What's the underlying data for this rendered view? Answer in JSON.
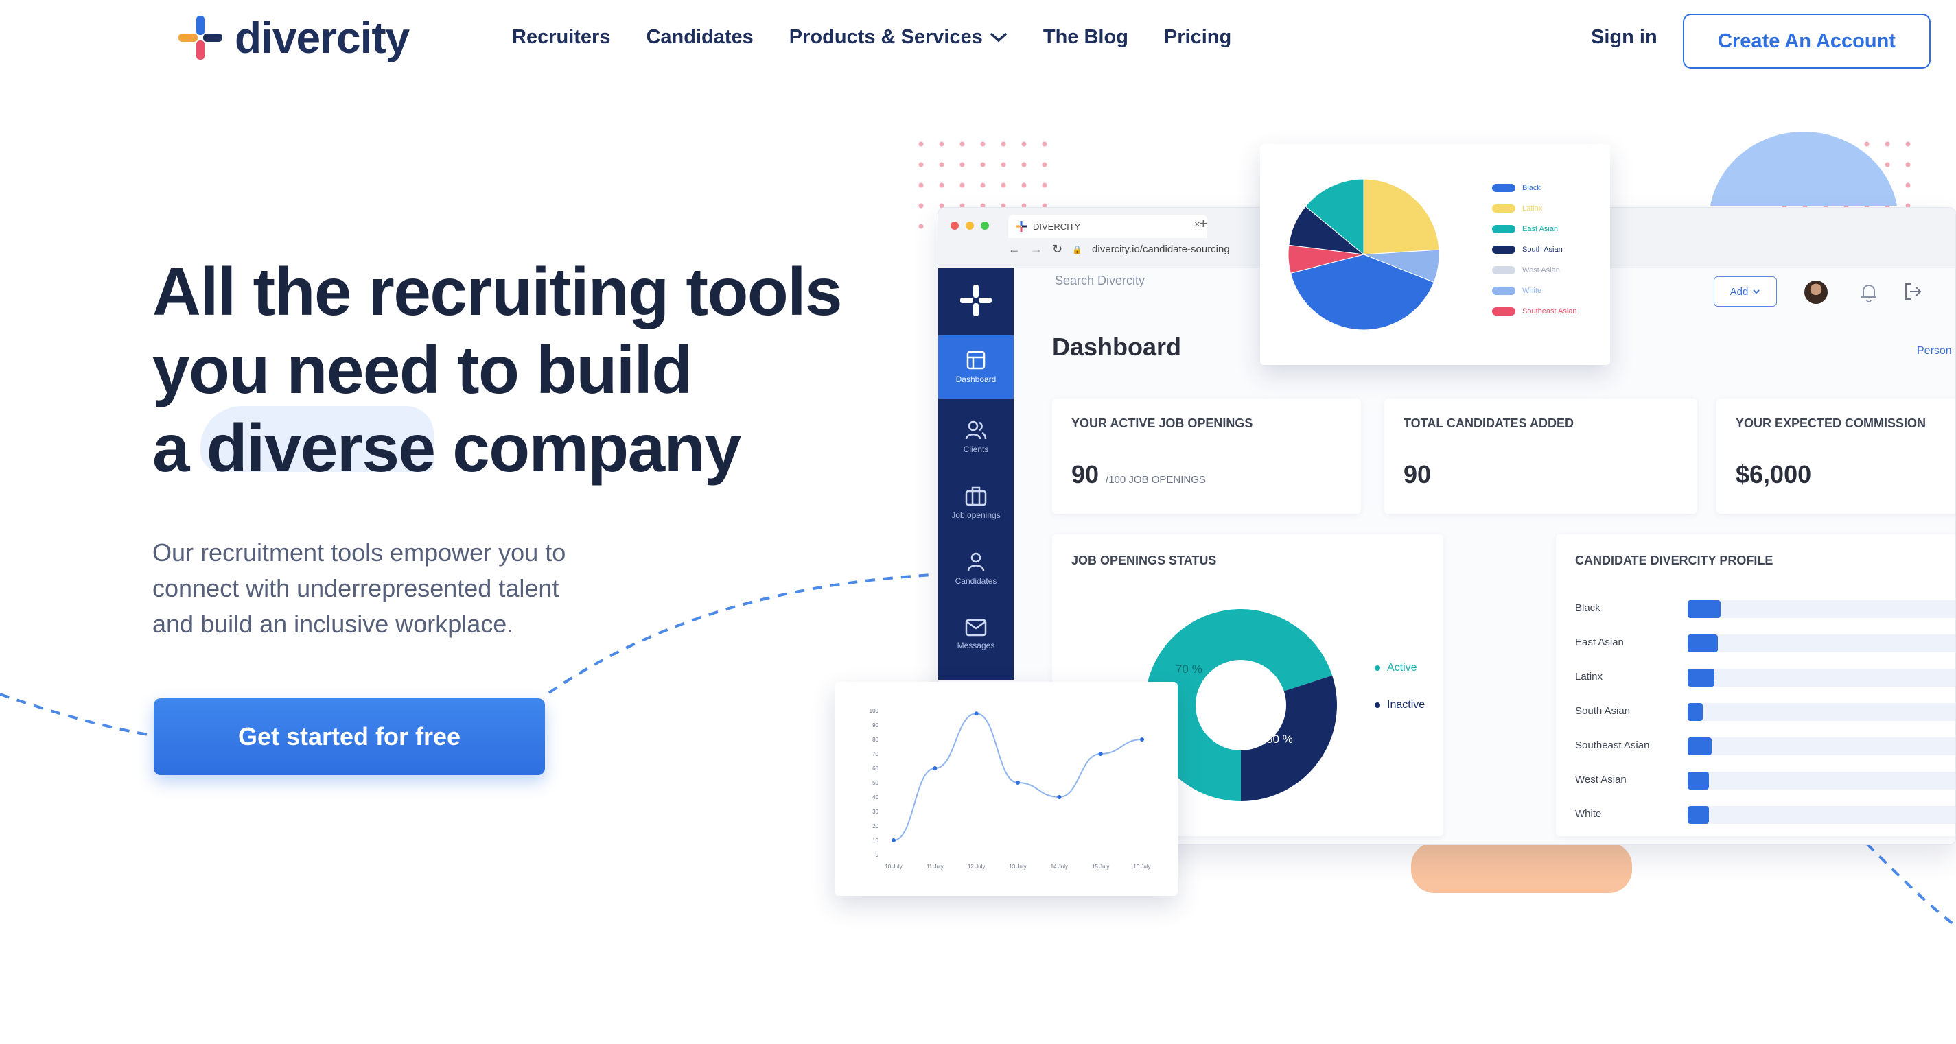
{
  "header": {
    "logo_text": "divercity",
    "nav": [
      "Recruiters",
      "Candidates",
      "Products & Services",
      "The Blog",
      "Pricing"
    ],
    "sign_in": "Sign in",
    "create_account": "Create An Account"
  },
  "hero": {
    "title_line1": "All the recruiting tools",
    "title_line2": "you need to build",
    "title_line3_a": "a ",
    "title_line3_hl": "diverse",
    "title_line3_b": " company",
    "subtitle": "Our recruitment tools empower you to connect with underrepresented talent and build an inclusive workplace.",
    "cta": "Get started for free"
  },
  "dashboard": {
    "tab_title": "DIVERCITY",
    "url": "divercity.io/candidate-sourcing",
    "search_placeholder": "Search Divercity",
    "add_button": "Add",
    "title": "Dashboard",
    "person_link": "Person",
    "sidebar": [
      "Dashboard",
      "Clients",
      "Job openings",
      "Candidates",
      "Messages"
    ],
    "stats": [
      {
        "label": "YOUR ACTIVE JOB OPENINGS",
        "value": "90",
        "sub": "/100 JOB OPENINGS"
      },
      {
        "label": "TOTAL CANDIDATES ADDED",
        "value": "90",
        "sub": ""
      },
      {
        "label": "YOUR EXPECTED COMMISSION",
        "value": "$6,000",
        "sub": ""
      }
    ],
    "job_status": {
      "title": "JOB OPENINGS STATUS",
      "legend": [
        "Active",
        "Inactive"
      ],
      "labels": [
        "70 %",
        "30 %"
      ]
    },
    "profile": {
      "title": "CANDIDATE DIVERCITY PROFILE",
      "rows": [
        {
          "label": "Black",
          "value": 0.11
        },
        {
          "label": "East Asian",
          "value": 0.1
        },
        {
          "label": "Latinx",
          "value": 0.09
        },
        {
          "label": "South Asian",
          "value": 0.05
        },
        {
          "label": "Southeast Asian",
          "value": 0.08
        },
        {
          "label": "West Asian",
          "value": 0.07
        },
        {
          "label": "White",
          "value": 0.07
        }
      ]
    }
  },
  "pie_legend": [
    {
      "label": "Black",
      "color": "#2f6fe0"
    },
    {
      "label": "Latinx",
      "color": "#f7d86b"
    },
    {
      "label": "East Asian",
      "color": "#16b3b3"
    },
    {
      "label": "South Asian",
      "color": "#162b66"
    },
    {
      "label": "West Asian",
      "color": "#d3d9e6"
    },
    {
      "label": "White",
      "color": "#8fb4ee"
    },
    {
      "label": "Southeast Asian",
      "color": "#ec4f6a"
    }
  ],
  "chart_data": [
    {
      "type": "pie",
      "title": "",
      "categories": [
        "Latinx",
        "White",
        "Black",
        "Southeast Asian",
        "South Asian",
        "East Asian"
      ],
      "values": [
        24,
        7,
        40,
        6,
        9,
        14
      ]
    },
    {
      "type": "pie",
      "title": "JOB OPENINGS STATUS",
      "categories": [
        "Active",
        "Inactive"
      ],
      "values": [
        70,
        30
      ]
    },
    {
      "type": "line",
      "title": "",
      "x": [
        "10 July",
        "11 July",
        "12 July",
        "13 July",
        "14 July",
        "15 July",
        "16 July"
      ],
      "y": [
        10,
        60,
        98,
        50,
        40,
        70,
        80
      ],
      "yticks": [
        "0",
        "10",
        "20",
        "30",
        "40",
        "50",
        "60",
        "70",
        "80",
        "90",
        "100"
      ],
      "ylim": [
        0,
        100
      ]
    }
  ],
  "colors": {
    "primary": "#2f6fe0",
    "navy": "#1e2f5c",
    "teal": "#16b3b3",
    "sidebar": "#162b66"
  }
}
